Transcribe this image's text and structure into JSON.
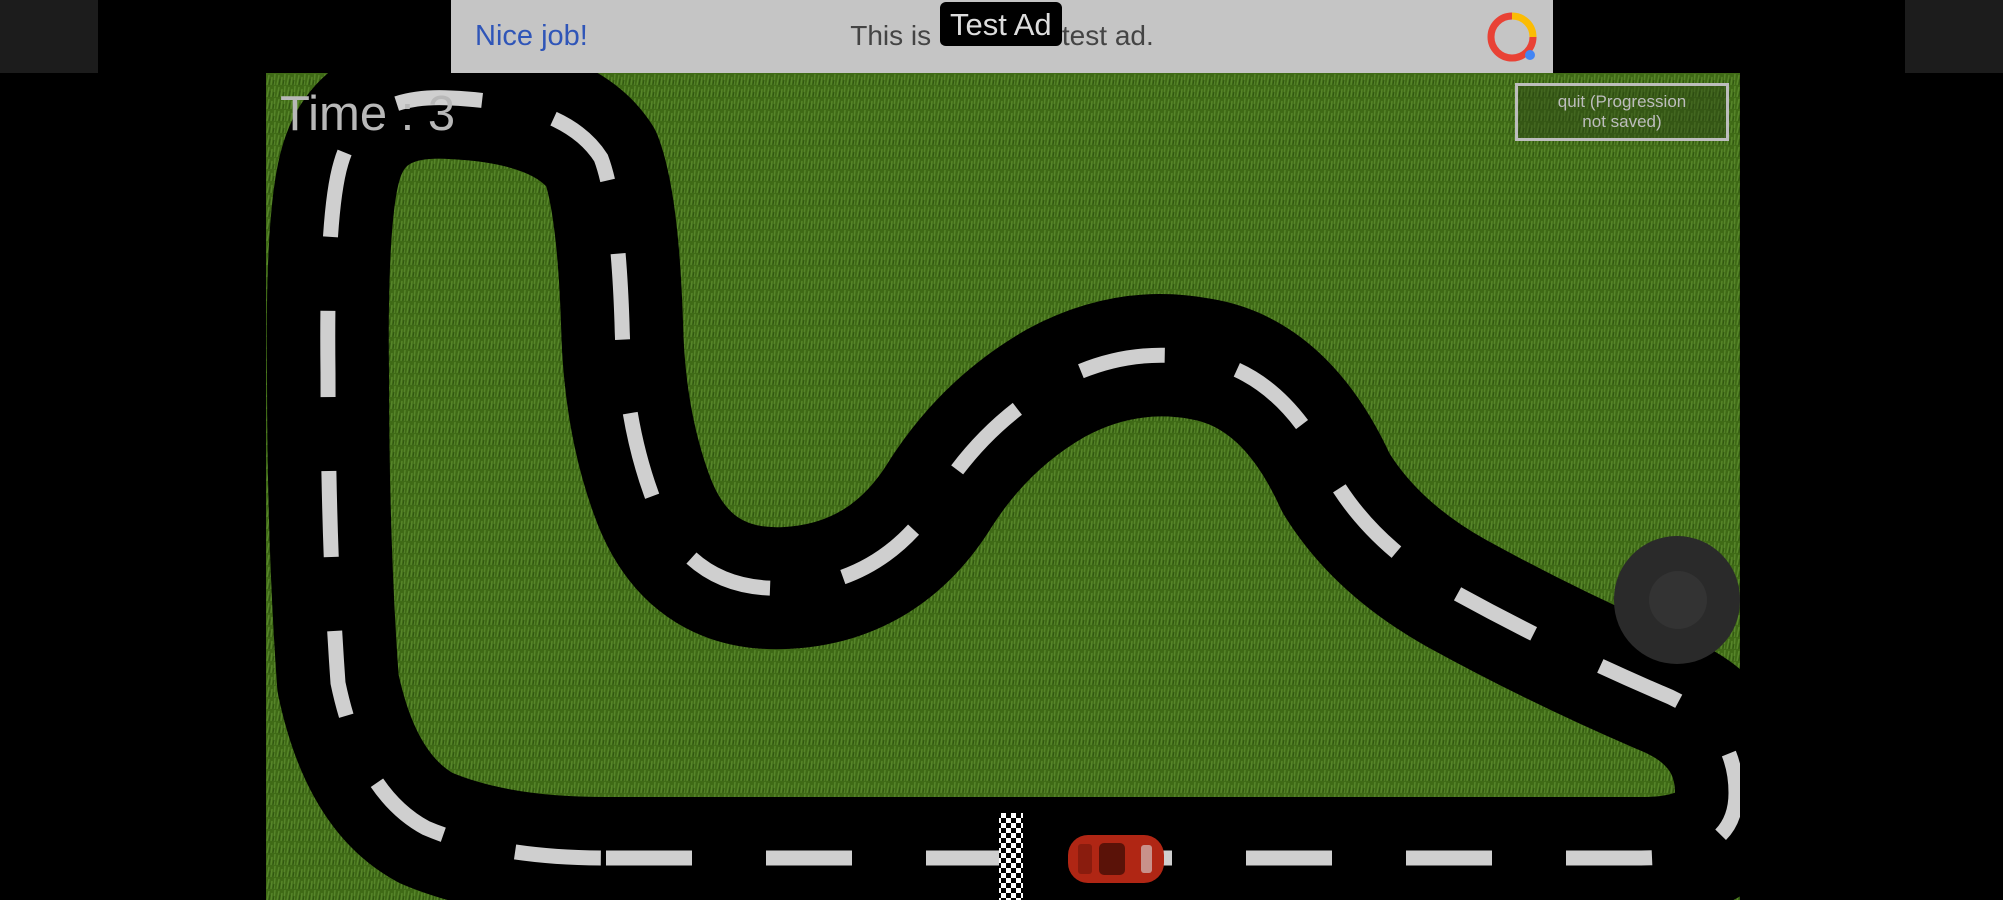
{
  "ad_banner": {
    "tag": "Test Ad",
    "headline": "Nice job!",
    "message": "This is a 320x32 test ad.",
    "logo": "google-ads-logo-icon",
    "colors": {
      "headline": "#2f55b8",
      "background": "#c5c5c5"
    }
  },
  "hud": {
    "timer": "Time : 3",
    "quit_button": {
      "line1": "quit (Progression",
      "line2": "not saved)"
    }
  },
  "game": {
    "surface": "grass",
    "track_color": "#000000",
    "lane_marking_color": "#cfcfcf",
    "finish_line": "checkered-flag-line",
    "car": {
      "name": "red-race-car",
      "color": "#b02614"
    },
    "joystick": "virtual-joystick-icon"
  }
}
